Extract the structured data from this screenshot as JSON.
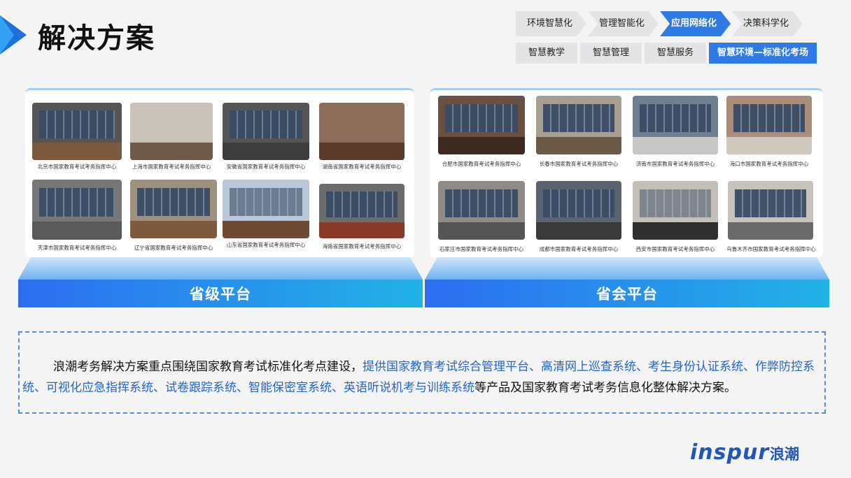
{
  "page": {
    "title": "解决方案"
  },
  "nav_primary": [
    {
      "label": "环境智慧化",
      "active": false
    },
    {
      "label": "管理智能化",
      "active": false
    },
    {
      "label": "应用网络化",
      "active": true
    },
    {
      "label": "决策科学化",
      "active": false
    }
  ],
  "nav_secondary": [
    {
      "label": "智慧教学",
      "active": false
    },
    {
      "label": "智慧管理",
      "active": false
    },
    {
      "label": "智慧服务",
      "active": false
    },
    {
      "label": "智慧环境—标准化考场",
      "active": true
    }
  ],
  "provincial": {
    "label": "省级平台",
    "captions": [
      "北京市国家教育考试考务指挥中心",
      "上海市国家教育考试考务指挥中心",
      "安徽省国家教育考试考务指挥中心",
      "湖南省国家教育考试考务指挥中心",
      "天津市国家教育考试考务指挥中心",
      "辽宁省国家教育考试考务指挥中心",
      "山东省国家教育考试考务指挥中心",
      "海南省国家教育考试考务指挥中心"
    ]
  },
  "capital": {
    "label": "省会平台",
    "captions": [
      "合肥市国家教育考试考务指挥中心",
      "长春市国家教育考试考务指挥中心",
      "济南市国家教育考试考务指挥中心",
      "海口市国家教育考试考务指挥中心",
      "石家庄市国家教育考试考务指挥中心",
      "成都市国家教育考试考务指挥中心",
      "西安市国家教育考试考务指挥中心",
      "乌鲁木齐市国家教育考试考务指挥中心"
    ]
  },
  "description": {
    "intro": "浪潮考务解决方案重点围绕国家教育考试标准化考点建设，",
    "highlight": "提供国家教育考试综合管理平台、高清网上巡查系统、考生身份认证系统、作弊防控系统、可视化应急指挥系统、试卷跟踪系统、智能保密室系统、英语听说机考与训练系统",
    "outro": "等产品及国家教育考试考务信息化整体解决方案。"
  },
  "brand": {
    "logo": "inspur",
    "name_cn": "浪潮"
  },
  "colors": {
    "accent": "#2f7be6",
    "highlight_text": "#2466c8",
    "bar_start": "#2d6ef0",
    "bar_end": "#22b2e6"
  }
}
